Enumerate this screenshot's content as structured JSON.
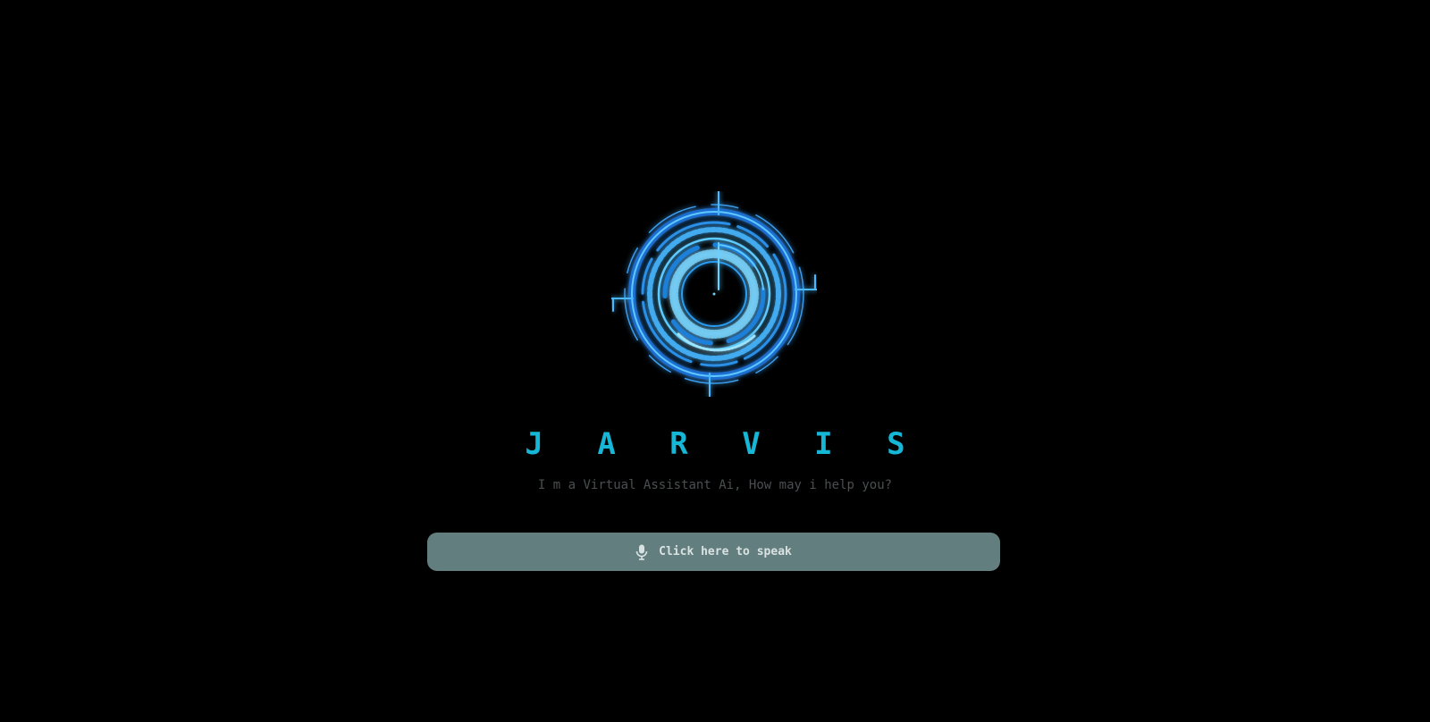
{
  "app": {
    "title": "J A R V I S",
    "subtitle": "I m a Virtual Assistant Ai, How may i help you?"
  },
  "speak_button": {
    "label": "Click here to speak",
    "icon": "microphone-icon"
  },
  "hud_graphic": {
    "icon": "jarvis-hud-ring-icon"
  },
  "colors": {
    "background": "#000000",
    "accent": "#16b7d6",
    "button_bg": "#637e7e",
    "subtitle": "#4a4f51"
  }
}
